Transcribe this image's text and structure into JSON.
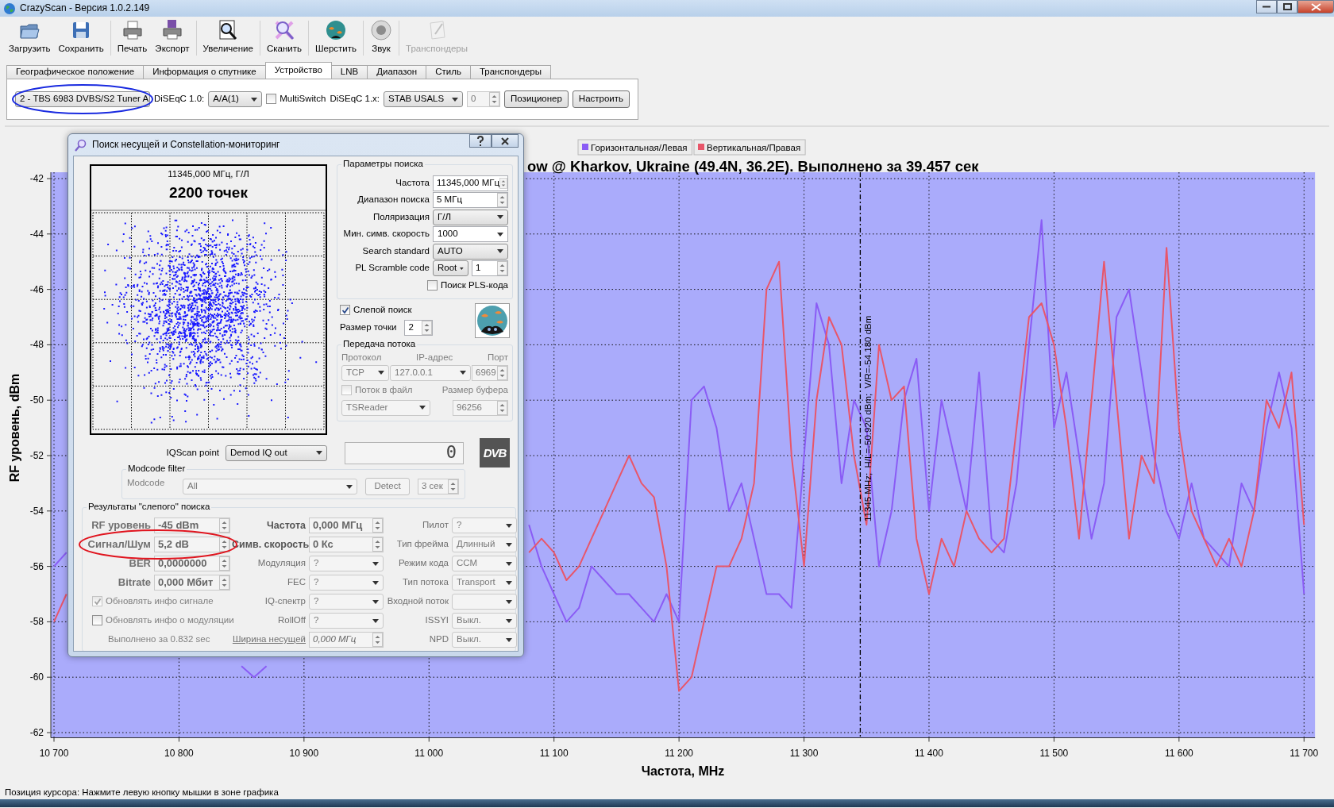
{
  "window": {
    "title": "CrazyScan - Версия 1.0.2.149"
  },
  "toolbar": [
    {
      "label": "Загрузить",
      "disabled": false
    },
    {
      "label": "Сохранить",
      "disabled": false
    },
    {
      "label": "Печать",
      "disabled": false
    },
    {
      "label": "Экспорт",
      "disabled": false
    },
    {
      "label": "Увеличение",
      "disabled": false
    },
    {
      "label": "Сканить",
      "disabled": false
    },
    {
      "label": "Шерстить",
      "disabled": false
    },
    {
      "label": "Звук",
      "disabled": false
    },
    {
      "label": "Транспондеры",
      "disabled": true
    }
  ],
  "tabs": [
    {
      "label": "Географическое положение",
      "selected": false
    },
    {
      "label": "Информация о спутнике",
      "selected": false
    },
    {
      "label": "Устройство",
      "selected": true
    },
    {
      "label": "LNB",
      "selected": false
    },
    {
      "label": "Диапазон",
      "selected": false
    },
    {
      "label": "Стиль",
      "selected": false
    },
    {
      "label": "Транспондеры",
      "selected": false
    }
  ],
  "device": {
    "tuner": {
      "value": "2 - TBS 6983 DVBS/S2 Tuner A",
      "circled": true
    },
    "diseqc10_label": "DiSEqC 1.0:",
    "diseqc10": "A/A(1)",
    "multiswitch": {
      "label": "MultiSwitch",
      "checked": false
    },
    "diseqc1x_label": "DiSEqC 1.x:",
    "diseqc1x": "STAB USALS",
    "position": {
      "value": "0",
      "disabled": true
    },
    "buttons": [
      "Позиционер",
      "Настроить"
    ]
  },
  "chart": {
    "title": "ow @ Kharkov, Ukraine (49.4N, 36.2E). Выполнено за 39.457 сек",
    "chart_data": {
      "type": "line",
      "xlabel": "Частота, MHz",
      "ylabel": "RF уровень, dBm",
      "xlim": [
        10700,
        11705
      ],
      "ylim": [
        -62.1,
        -41.8
      ],
      "grid": true,
      "legend": "top",
      "xticks": [
        {
          "value": 10700,
          "label": "10 700"
        },
        {
          "value": 10800,
          "label": "10 800"
        },
        {
          "value": 10900,
          "label": "10 900"
        },
        {
          "value": 11000,
          "label": "11 000"
        },
        {
          "value": 11100,
          "label": "11 100"
        },
        {
          "value": 11200,
          "label": "11 200"
        },
        {
          "value": 11300,
          "label": "11 300"
        },
        {
          "value": 11400,
          "label": "11 400"
        },
        {
          "value": 11500,
          "label": "11 500"
        },
        {
          "value": 11600,
          "label": "11 600"
        },
        {
          "value": 11700,
          "label": "11 700"
        }
      ],
      "yticks": [
        -42,
        -44,
        -46,
        -48,
        -50,
        -52,
        -54,
        -56,
        -58,
        -60,
        -62
      ],
      "x": [
        10700,
        10710,
        10850,
        10860,
        10870,
        11080,
        11090,
        11100,
        11110,
        11120,
        11130,
        11140,
        11150,
        11160,
        11170,
        11180,
        11190,
        11200,
        11210,
        11220,
        11230,
        11240,
        11250,
        11260,
        11270,
        11280,
        11290,
        11300,
        11310,
        11320,
        11330,
        11340,
        11350,
        11360,
        11370,
        11380,
        11390,
        11400,
        11410,
        11420,
        11430,
        11440,
        11450,
        11460,
        11470,
        11480,
        11490,
        11500,
        11510,
        11520,
        11530,
        11540,
        11550,
        11560,
        11570,
        11580,
        11590,
        11600,
        11610,
        11620,
        11630,
        11640,
        11650,
        11660,
        11670,
        11680,
        11690,
        11700
      ],
      "series": [
        {
          "name": "Горизонтальная/Левая",
          "color": "#8a5cf5",
          "values": [
            -56,
            -55.5,
            -59.6,
            -60,
            -59.6,
            -54.5,
            -56,
            -57,
            -58,
            -57.5,
            -56,
            -56.5,
            -57,
            -57,
            -57.5,
            -58,
            -57,
            -58,
            -50,
            -49.5,
            -51,
            -54,
            -53,
            -55,
            -57,
            -57,
            -57.5,
            -52,
            -46.5,
            -48,
            -53,
            -50,
            -51,
            -56,
            -54,
            -50,
            -48.5,
            -54,
            -50,
            -52,
            -54,
            -49,
            -55,
            -55.5,
            -53,
            -48,
            -43.5,
            -51,
            -49,
            -52,
            -55,
            -53,
            -47,
            -46,
            -49,
            -52,
            -54,
            -55,
            -53,
            -55,
            -55.5,
            -56,
            -53,
            -54,
            -51,
            -49,
            -51,
            -57
          ]
        },
        {
          "name": "Вертикальная/Правая",
          "color": "#e8566a",
          "values": [
            -58,
            -57,
            null,
            null,
            null,
            -55.5,
            -55,
            -55.5,
            -56.5,
            -56,
            -55,
            -54,
            -53,
            -52,
            -53,
            -53.5,
            -56,
            -60.5,
            -60,
            -58,
            -56,
            -56,
            -55,
            -53,
            -46,
            -45,
            -52,
            -56,
            -50,
            -47,
            -48,
            -52,
            -54.5,
            -48,
            -50,
            -49.5,
            -55,
            -57,
            -55,
            -56,
            -54,
            -55,
            -55.5,
            -55,
            -51,
            -47,
            -46.5,
            -48,
            -51,
            -55,
            -50,
            -45,
            -50,
            -55,
            -52,
            -53,
            -44.5,
            -51,
            -54,
            -55,
            -56,
            -55,
            -56,
            -54,
            -50,
            -51,
            -49,
            -54.5
          ]
        }
      ],
      "ref_lines": [
        {
          "axis": "x",
          "value": 11345,
          "label": "11345 MHz;  H/L=-50.920 dBm;  V/R=-54.180 dBm"
        }
      ]
    }
  },
  "dialog": {
    "title": "Поиск несущей и Constellation-мониторинг",
    "constellation": {
      "frequency": "11345,000 МГц, Г/Л",
      "points": "2200 точек"
    },
    "search_params": {
      "title": "Параметры поиска",
      "fields": [
        {
          "kind": "spin",
          "label": "Частота",
          "value": "11345,000 МГц"
        },
        {
          "kind": "spin",
          "label": "Диапазон поиска",
          "value": "5 МГц"
        },
        {
          "kind": "combo",
          "label": "Поляризация",
          "value": "Г/Л"
        },
        {
          "kind": "editcombo",
          "label": "Мин. симв. скорость",
          "value": "1000"
        },
        {
          "kind": "combo",
          "label": "Search standard",
          "value": "AUTO"
        },
        {
          "kind": "pair",
          "label": "PL Scramble code",
          "value": "Root",
          "value2": "1"
        }
      ],
      "pls": {
        "label": "Поиск PLS-кода",
        "checked": false
      }
    },
    "blind": {
      "label": "Слепой поиск",
      "checked": true
    },
    "point_size": {
      "label": "Размер точки",
      "value": "2"
    },
    "stream": {
      "title": "Передача потока",
      "protocol_label": "Протокол",
      "ip_label": "IP-адрес",
      "port_label": "Порт",
      "protocol": "TCP",
      "ip": "127.0.0.1",
      "port": "6969",
      "to_file": {
        "label": "Поток в файл",
        "checked": false
      },
      "buffer_label": "Размер буфера",
      "reader": "TSReader",
      "buffer": "96256"
    },
    "counter": "0",
    "logo": "DVB",
    "iqscan": {
      "label": "IQScan point",
      "value": "Demod IQ out"
    },
    "modcode": {
      "title": "Modcode filter",
      "label": "Modcode",
      "value": "All",
      "detect": "Detect",
      "time": "3 сек"
    },
    "results": {
      "title": "Результаты \"слепого\" поиска",
      "col1": [
        {
          "kind": "spin",
          "label": "RF уровень",
          "value": "-45 dBm",
          "circled": false
        },
        {
          "kind": "spin",
          "label": "Сигнал/Шум",
          "value": "5,2 dB",
          "circled": true
        },
        {
          "kind": "spin",
          "label": "BER",
          "value": "0,0000000",
          "circled": false
        },
        {
          "kind": "spin",
          "label": "Bitrate",
          "value": "0,000 Мбит",
          "circled": false
        },
        {
          "kind": "check",
          "label": "Обновлять инфо сигнале",
          "checked": true
        },
        {
          "kind": "check",
          "label": "Обновлять инфо о модуляции",
          "checked": false
        },
        {
          "kind": "text",
          "label": "Выполнено за 0.832 sec"
        }
      ],
      "col2": [
        {
          "kind": "spin",
          "label": "Частота",
          "value": "0,000 МГц"
        },
        {
          "kind": "spin",
          "label": "Симв. скорость",
          "value": "0 Кс"
        },
        {
          "kind": "combo",
          "label": "Модуляция",
          "value": "?"
        },
        {
          "kind": "combo",
          "label": "FEC",
          "value": "?"
        },
        {
          "kind": "combo",
          "label": "IQ-спектр",
          "value": "?"
        },
        {
          "kind": "combo",
          "label": "RollOff",
          "value": "?"
        },
        {
          "kind": "link",
          "label": "Ширина несущей",
          "value": "0,000 МГц"
        }
      ],
      "col3": [
        {
          "kind": "combo",
          "label": "Пилот",
          "value": "?"
        },
        {
          "kind": "combo",
          "label": "Тип фрейма",
          "value": "Длинный"
        },
        {
          "kind": "combo",
          "label": "Режим кода",
          "value": "CCM"
        },
        {
          "kind": "combo",
          "label": "Тип потока",
          "value": "Transport"
        },
        {
          "kind": "combo",
          "label": "Входной поток"
        },
        {
          "kind": "combo",
          "label": "ISSYI",
          "value": "Выкл."
        },
        {
          "kind": "combo",
          "label": "NPD",
          "value": "Выкл."
        }
      ]
    }
  },
  "status_bar": "Позиция курсора: Нажмите левую кнопку мышки в зоне графика"
}
